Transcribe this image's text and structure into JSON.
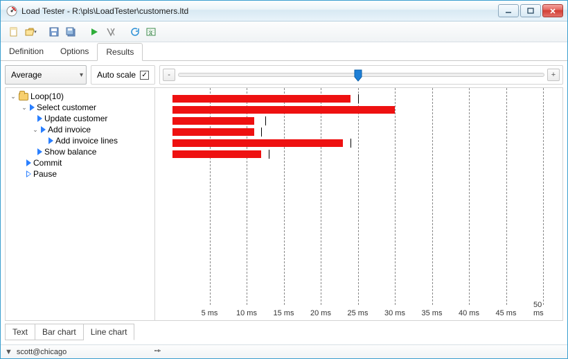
{
  "window": {
    "title": "Load Tester - R:\\pls\\LoadTester\\customers.ltd"
  },
  "toolbar": {
    "new": "new",
    "open": "open",
    "save": "save",
    "saveall": "saveall",
    "run": "run",
    "stop": "stop",
    "refresh": "refresh",
    "export": "export"
  },
  "tabs": {
    "definition": "Definition",
    "options": "Options",
    "results": "Results",
    "active": "results"
  },
  "controls": {
    "metric_select": "Average",
    "autoscale_label": "Auto scale",
    "autoscale_checked": true
  },
  "zoom": {
    "min": "-",
    "max": "+",
    "position_pct": 48
  },
  "tree": {
    "root": {
      "label": "Loop(10)"
    },
    "items": [
      {
        "label": "Select customer",
        "indent": 1
      },
      {
        "label": "Update customer",
        "indent": 2
      },
      {
        "label": "Add invoice",
        "indent": 2
      },
      {
        "label": "Add invoice lines",
        "indent": 3
      },
      {
        "label": "Show balance",
        "indent": 2
      },
      {
        "label": "Commit",
        "indent": 1
      },
      {
        "label": "Pause",
        "indent": 1,
        "hollow": true
      }
    ]
  },
  "chart_data": {
    "type": "bar",
    "xlabel": "",
    "ylabel": "",
    "x_unit": "ms",
    "x_ticks": [
      5,
      10,
      15,
      20,
      25,
      30,
      35,
      40,
      45,
      50
    ],
    "x_max": 50,
    "series": [
      {
        "name": "Select customer",
        "avg": 24,
        "marker": 25
      },
      {
        "name": "Update customer",
        "avg": 30,
        "marker": null
      },
      {
        "name": "Add invoice",
        "avg": 11,
        "marker": 12.5
      },
      {
        "name": "Add invoice lines",
        "avg": 11,
        "marker": 12
      },
      {
        "name": "Show balance",
        "avg": 23,
        "marker": 24
      },
      {
        "name": "Commit",
        "avg": 12,
        "marker": 13
      }
    ]
  },
  "bottom_tabs": {
    "text": "Text",
    "bar": "Bar chart",
    "line": "Line chart",
    "active": "line"
  },
  "statusbar": {
    "connection": "scott@chicago"
  }
}
